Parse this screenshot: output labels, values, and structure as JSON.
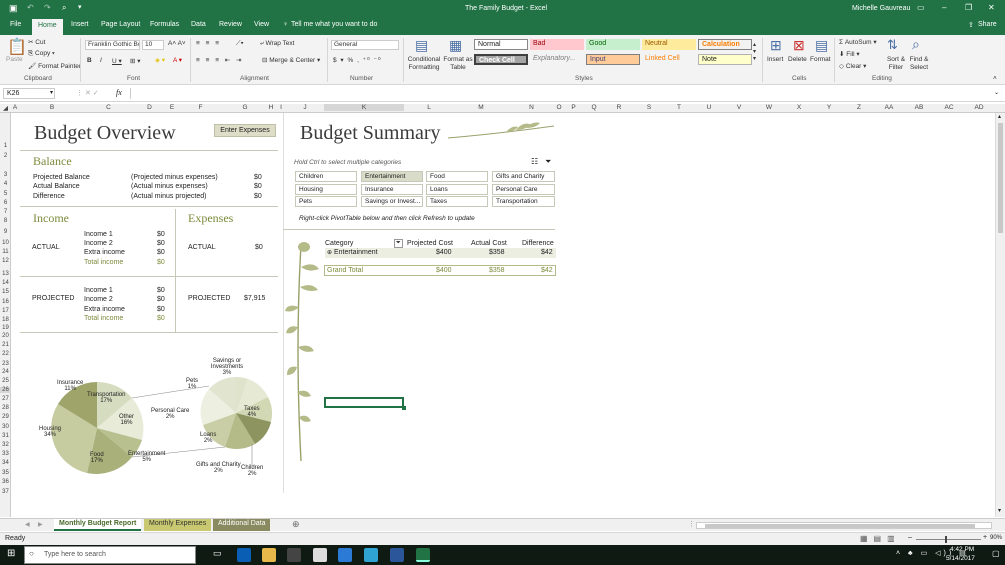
{
  "window": {
    "title": "The Family Budget - Excel",
    "user": "Michelle Gauvreau"
  },
  "tabs": [
    "File",
    "Home",
    "Insert",
    "Page Layout",
    "Formulas",
    "Data",
    "Review",
    "View"
  ],
  "tell_me": "Tell me what you want to do",
  "share": "Share",
  "ribbon": {
    "clipboard": {
      "paste": "Paste",
      "cut": "Cut",
      "copy": "Copy",
      "format_painter": "Format Painter",
      "label": "Clipboard"
    },
    "font": {
      "name": "Franklin Gothic Bo",
      "size": "10",
      "label": "Font"
    },
    "alignment": {
      "wrap": "Wrap Text",
      "merge": "Merge & Center",
      "label": "Alignment"
    },
    "number": {
      "format": "General",
      "label": "Number"
    },
    "styles": {
      "conditional": "Conditional Formatting",
      "format_table": "Format as Table",
      "normal": "Normal",
      "bad": "Bad",
      "good": "Good",
      "neutral": "Neutral",
      "calculation": "Calculation",
      "check_cell": "Check Cell",
      "explanatory": "Explanatory...",
      "input": "Input",
      "linked_cell": "Linked Cell",
      "note": "Note",
      "label": "Styles"
    },
    "cells": {
      "insert": "Insert",
      "delete": "Delete",
      "format": "Format",
      "label": "Cells"
    },
    "editing": {
      "autosum": "AutoSum",
      "fill": "Fill",
      "clear": "Clear",
      "sort": "Sort & Filter",
      "find": "Find & Select",
      "label": "Editing"
    }
  },
  "formula_bar": {
    "name_box": "K26",
    "fx": "fx",
    "content": ""
  },
  "columns": [
    "A",
    "B",
    "C",
    "D",
    "E",
    "F",
    "G",
    "H",
    "I",
    "J",
    "K",
    "L",
    "M",
    "N",
    "O",
    "P",
    "Q",
    "R",
    "S",
    "T",
    "U",
    "V",
    "W",
    "X",
    "Y",
    "Z",
    "AA",
    "AB",
    "AC",
    "AD"
  ],
  "rows": [
    "1",
    "2",
    "3",
    "4",
    "5",
    "6",
    "7",
    "8",
    "9",
    "10",
    "11",
    "12",
    "13",
    "14",
    "15",
    "16",
    "17",
    "18",
    "19",
    "20",
    "21",
    "22",
    "23",
    "24",
    "25",
    "26",
    "27",
    "28",
    "29",
    "30",
    "31",
    "32",
    "33",
    "34",
    "35",
    "36",
    "37"
  ],
  "overview": {
    "title": "Budget Overview",
    "enter_expenses": "Enter Expenses",
    "balance_title": "Balance",
    "balance_rows": [
      {
        "label": "Projected Balance",
        "note": "(Projected  minus expenses)",
        "value": "$0"
      },
      {
        "label": "Actual Balance",
        "note": "(Actual  minus expenses)",
        "value": "$0"
      },
      {
        "label": "Difference",
        "note": "(Actual minus projected)",
        "value": "$0"
      }
    ],
    "income_title": "Income",
    "expenses_title": "Expenses",
    "actual": "ACTUAL",
    "projected": "PROJECTED",
    "income_actual": [
      {
        "label": "Income 1",
        "value": "$0"
      },
      {
        "label": "Income 2",
        "value": "$0"
      },
      {
        "label": "Extra income",
        "value": "$0"
      },
      {
        "label": "Total income",
        "value": "$0"
      }
    ],
    "income_projected": [
      {
        "label": "Income 1",
        "value": "$0"
      },
      {
        "label": "Income 2",
        "value": "$0"
      },
      {
        "label": "Extra income",
        "value": "$0"
      },
      {
        "label": "Total income",
        "value": "$0"
      }
    ],
    "expenses_actual": "$0",
    "expenses_projected": "$7,915"
  },
  "pie": {
    "main": [
      {
        "label": "Insurance",
        "pct": "11%"
      },
      {
        "label": "Transportation",
        "pct": "17%"
      },
      {
        "label": "Other",
        "pct": "16%"
      },
      {
        "label": "Housing",
        "pct": "34%"
      },
      {
        "label": "Food",
        "pct": "17%"
      },
      {
        "label": "Entertainment",
        "pct": "5%"
      }
    ],
    "other": [
      {
        "label": "Savings or Investments",
        "pct": "3%"
      },
      {
        "label": "Pets",
        "pct": "1%"
      },
      {
        "label": "Personal Care",
        "pct": "2%"
      },
      {
        "label": "Taxes",
        "pct": "4%"
      },
      {
        "label": "Loans",
        "pct": "2%"
      },
      {
        "label": "Gifts and Charity",
        "pct": "2%"
      },
      {
        "label": "Children",
        "pct": "2%"
      }
    ]
  },
  "summary": {
    "title": "Budget Summary",
    "hint": "Hold Ctrl to select multiple categories",
    "slicer": [
      "Children",
      "Entertainment",
      "Food",
      "Gifts and Charity",
      "Housing",
      "Insurance",
      "Loans",
      "Personal Care",
      "Pets",
      "Savings or Invest...",
      "Taxes",
      "Transportation"
    ],
    "refresh_note": "Right-click PivotTable below and then click Refresh to update",
    "pivot_headers": [
      "Category",
      "Projected Cost",
      "Actual Cost",
      "Difference"
    ],
    "pivot_row": {
      "category": "Entertainment",
      "projected": "$400",
      "actual": "$358",
      "diff": "$42"
    },
    "grand_total": {
      "label": "Grand Total",
      "projected": "$400",
      "actual": "$358",
      "diff": "$42"
    }
  },
  "sheet_tabs": [
    "Monthly Budget Report",
    "Monthly Expenses",
    "Additional Data"
  ],
  "status": {
    "ready": "Ready",
    "zoom": "90%"
  },
  "taskbar": {
    "search": "Type here to search",
    "time": "4:42 PM",
    "date": "5/14/2017"
  }
}
